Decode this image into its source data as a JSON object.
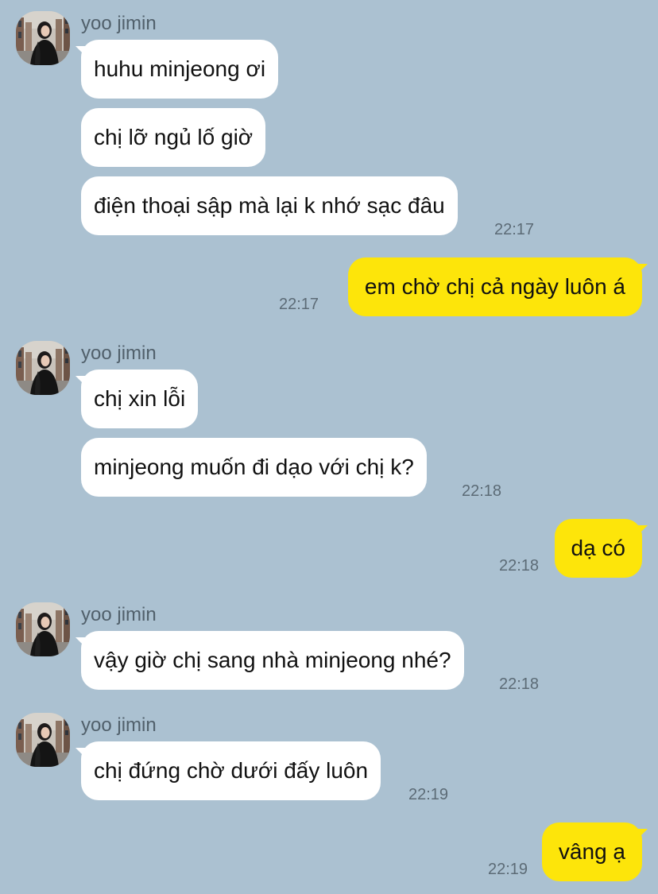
{
  "chat": {
    "contact_name": "yoo jimin",
    "messages": [
      {
        "text": "huhu minjeong ơi"
      },
      {
        "text": "chị lỡ ngủ lố giờ"
      },
      {
        "text": "điện thoại sập mà lại k nhớ sạc đâu",
        "time": "22:17"
      },
      {
        "text": "em chờ chị cả ngày luôn á",
        "time": "22:17"
      },
      {
        "text": "chị xin lỗi"
      },
      {
        "text": "minjeong muốn đi dạo với chị k?",
        "time": "22:18"
      },
      {
        "text": "dạ có",
        "time": "22:18"
      },
      {
        "text": "vậy giờ chị sang nhà minjeong nhé?",
        "time": "22:18"
      },
      {
        "text": "chị đứng chờ dưới đấy luôn",
        "time": "22:19"
      },
      {
        "text": "vâng ạ",
        "time": "22:19"
      }
    ]
  },
  "colors": {
    "background": "#abc1d1",
    "incoming_bubble": "#ffffff",
    "outgoing_bubble": "#fde50a",
    "timestamp": "#5c6b76",
    "sender_name": "#51606b"
  },
  "icons": {
    "avatar": "profile-photo"
  }
}
